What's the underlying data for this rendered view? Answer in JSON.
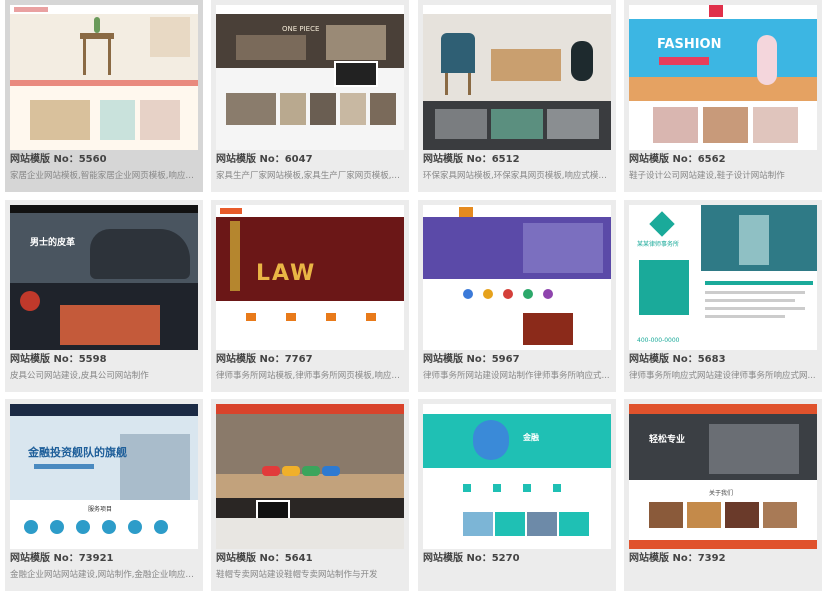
{
  "cards": [
    {
      "title": "网站模版 No：5560",
      "desc": "家居企业网站模板,智能家居企业网页模板,响应式..."
    },
    {
      "title": "网站模版 No：6047",
      "desc": "家具生产厂家网站模板,家具生产厂家网页模板,响..."
    },
    {
      "title": "网站模版 No：6512",
      "desc": "环保家具网站模板,环保家具网页模板,响应式模板..."
    },
    {
      "title": "网站模版 No：6562",
      "desc": "鞋子设计公司网站建设,鞋子设计网站制作"
    },
    {
      "title": "网站模版 No：5598",
      "desc": "皮具公司网站建设,皮具公司网站制作"
    },
    {
      "title": "网站模版 No：7767",
      "desc": "律师事务所网站模板,律师事务所网页模板,响应式..."
    },
    {
      "title": "网站模版 No：5967",
      "desc": "律师事务所网站建设网站制作律师事务所响应式..."
    },
    {
      "title": "网站模版 No：5683",
      "desc": "律师事务所响应式网站建设律师事务所响应式网..."
    },
    {
      "title": "网站模版 No：73921",
      "desc": "金融企业网站网站建设,网站制作,金融企业响应式..."
    },
    {
      "title": "网站模版 No：5641",
      "desc": "鞋帽专卖网站建设鞋帽专卖网站制作与开发"
    },
    {
      "title": "网站模版 No：5270",
      "desc": ""
    },
    {
      "title": "网站模版 No：7392",
      "desc": ""
    }
  ],
  "thumb_text": {
    "t2_banner": "ONE PIECE",
    "t4_fashion": "FASHION",
    "t5_banner": "男士的皮革",
    "t6_law": "LAW",
    "t8_brand": "某某律师事务所",
    "t8_phone": "400-000-0000",
    "t9_banner": "金融投资舰队的旗舰",
    "t9_sub": "服务项目",
    "t11_banner": "金融",
    "t12_banner": "轻松专业",
    "t12_sub": "关于我们"
  }
}
